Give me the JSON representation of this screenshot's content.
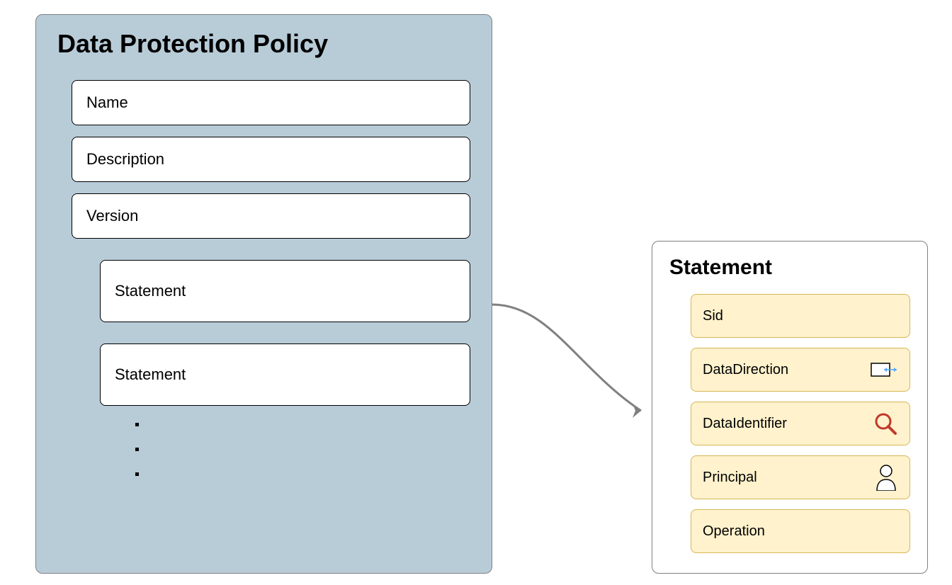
{
  "policy": {
    "title": "Data Protection Policy",
    "fields": [
      "Name",
      "Description",
      "Version"
    ],
    "statements": [
      "Statement",
      "Statement"
    ]
  },
  "statement_detail": {
    "title": "Statement",
    "items": [
      {
        "label": "Sid",
        "icon": null
      },
      {
        "label": "DataDirection",
        "icon": "direction"
      },
      {
        "label": "DataIdentifier",
        "icon": "search"
      },
      {
        "label": "Principal",
        "icon": "user"
      },
      {
        "label": "Operation",
        "icon": null
      }
    ]
  }
}
